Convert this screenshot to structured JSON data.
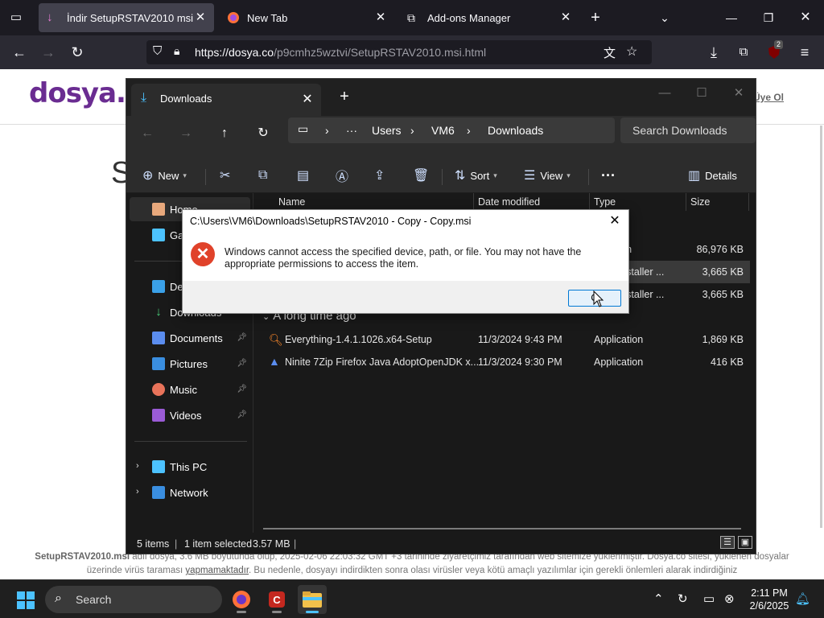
{
  "browser": {
    "tabs": [
      {
        "label": "İndir SetupRSTAV2010 msi",
        "active": true
      },
      {
        "label": "New Tab",
        "active": false
      },
      {
        "label": "Add-ons Manager",
        "active": false
      }
    ],
    "url_host": "https://dosya.co",
    "url_path": "/p9cmhz5wztvi/SetupRSTAV2010.msi.html",
    "extension_badge": "2"
  },
  "webpage": {
    "logo_text": "dosya.c",
    "signup_link": "Üye Ol",
    "heading_fragment": "S",
    "description_bold": "SetupRSTAV2010.msi",
    "description_part1": " adlı dosya, 3.6 MB boyutunda olup, 2025-02-06 22:03:32 GMT +3 tarihinde ziyaretçimiz tarafından web sitemize yüklenmiştir. Dosya.co sitesi, yüklenen dosyalar üzerinde virüs taraması ",
    "description_link": "yapmamaktadır",
    "description_part2": ". Bu nedenle, dosyayı indirdikten sonra olası virüsler veya kötü amaçlı yazılımlar için gerekli önlemleri alarak indirdiğiniz"
  },
  "explorer": {
    "tab_label": "Downloads",
    "breadcrumb": [
      "Users",
      "VM6",
      "Downloads"
    ],
    "search_placeholder": "Search Downloads",
    "toolbar": {
      "new_label": "New",
      "sort_label": "Sort",
      "view_label": "View",
      "details_label": "Details"
    },
    "nav": {
      "home": "Home",
      "gallery": "Ga",
      "desktop": "De",
      "downloads": "Downloads",
      "documents": "Documents",
      "pictures": "Pictures",
      "music": "Music",
      "videos": "Videos",
      "this_pc": "This PC",
      "network": "Network"
    },
    "columns": {
      "name": "Name",
      "date": "Date modified",
      "type": "Type",
      "size": "Size"
    },
    "rows_partial": [
      {
        "type": "ation",
        "size": "86,976 KB"
      },
      {
        "type": "s Installer ...",
        "size": "3,665 KB"
      },
      {
        "type": "s Installer ...",
        "size": "3,665 KB"
      }
    ],
    "group_header": "A long time ago",
    "files": [
      {
        "name": "Everything-1.4.1.1026.x64-Setup",
        "date": "11/3/2024 9:43 PM",
        "type": "Application",
        "size": "1,869 KB"
      },
      {
        "name": "Ninite 7Zip Firefox Java AdoptOpenJDK x...",
        "date": "11/3/2024 9:30 PM",
        "type": "Application",
        "size": "416 KB"
      }
    ],
    "status": {
      "items": "5 items",
      "selected": "1 item selected",
      "size": "3.57 MB"
    }
  },
  "dialog": {
    "title": "C:\\Users\\VM6\\Downloads\\SetupRSTAV2010 - Copy - Copy.msi",
    "message": "Windows cannot access the specified device, path, or file. You may not have the appropriate permissions to access the item.",
    "ok_label": "O"
  },
  "taskbar": {
    "search_label": "Search",
    "time": "2:11 PM",
    "date": "2/6/2025"
  },
  "colors": {
    "accent": "#0078d4",
    "error": "#e0422a",
    "brand": "#6a2c91"
  }
}
